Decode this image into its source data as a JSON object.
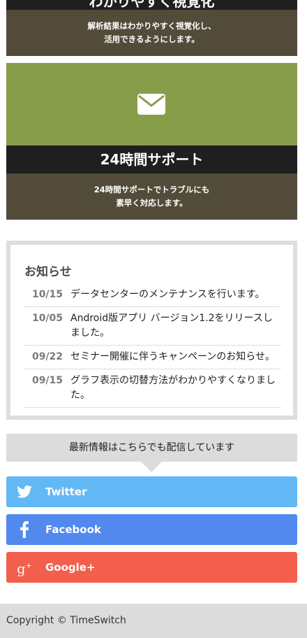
{
  "features": [
    {
      "title": "わかりやすく視覚化",
      "description_lines": [
        "解析結果はわかりやすく視覚化し、",
        "活用できるようにします。"
      ]
    },
    {
      "icon": "envelope-icon",
      "title": "24時間サポート",
      "description_lines": [
        "24時間サポートでトラブルにも",
        "素早く対応します。"
      ]
    }
  ],
  "news": {
    "title": "お知らせ",
    "items": [
      {
        "date": "10/15",
        "text": "データセンターのメンテナンスを行います。"
      },
      {
        "date": "10/05",
        "text": "Android版アプリ バージョン1.2をリリースしました。"
      },
      {
        "date": "09/22",
        "text": "セミナー開催に伴うキャンペーンのお知らせ。"
      },
      {
        "date": "09/15",
        "text": "グラフ表示の切替方法がわかりやすくなりました。"
      }
    ]
  },
  "share": {
    "heading": "最新情報はこちらでも配信しています",
    "buttons": [
      {
        "label": "Twitter",
        "icon": "twitter-icon",
        "color": "#62b8f4"
      },
      {
        "label": "Facebook",
        "icon": "facebook-icon",
        "color": "#5189ef"
      },
      {
        "label": "Google+",
        "icon": "google-plus-icon",
        "color": "#f25f4c"
      }
    ]
  },
  "footer": {
    "copyright": "Copyright © TimeSwitch"
  },
  "colors": {
    "feature_green": "#889d4a",
    "feature_dark": "#1f1f1f",
    "feature_brown": "#524b39"
  }
}
